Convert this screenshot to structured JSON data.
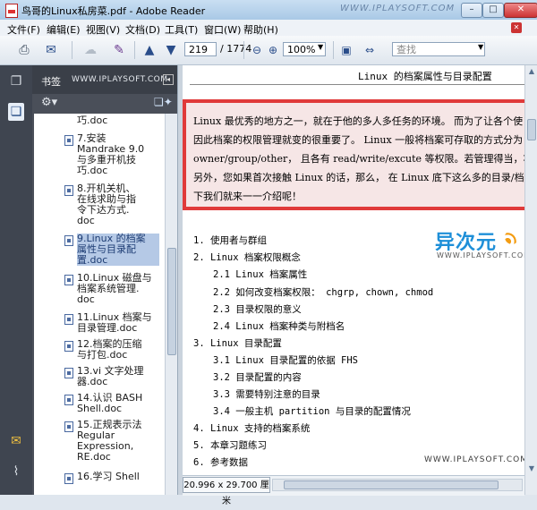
{
  "window": {
    "title": "鸟哥的Linux私房菜.pdf - Adobe Reader",
    "brand": "WWW.IPLAYSOFT.COM",
    "minimize": "–",
    "maximize": "□",
    "close": "✕"
  },
  "menu": [
    "文件(F)",
    "编辑(E)",
    "视图(V)",
    "文档(D)",
    "工具(T)",
    "窗口(W)",
    "帮助(H)"
  ],
  "toolbar": {
    "page_current": "219",
    "page_total": "/ 1774",
    "zoom": "100%",
    "search_placeholder": "查找"
  },
  "bookmarks": {
    "header": "书签",
    "brand": "WWW.IPLAYSOFT.COM",
    "items": [
      "巧.doc",
      "7.安装\nMandrake 9.0\n与多重开机技\n巧.doc",
      "8.开机关机、\n在线求助与指\n令下达方式.\ndoc",
      "9.Linux 的档案\n属性与目录配\n置.doc",
      "10.Linux 磁盘与\n档案系统管理.\ndoc",
      "11.Linux 档案与\n目录管理.doc",
      "12.档案的压缩\n与打包.doc",
      "13.vi 文字处理\n器.doc",
      "14.认识 BASH\nShell.doc",
      "15.正规表示法\nRegular\nExpression,\nRE.doc",
      "16.学习 Shell"
    ],
    "selected_index": 3
  },
  "document": {
    "running_head": "Linux 的档案属性与目录配置",
    "callout_lines": [
      "Linux 最优秀的地方之一，就在于他的多人多任务的环境。 而为了让各个使",
      "因此档案的权限管理就变的很重要了。 Linux 一般将档案可存取的方式分为",
      "owner/group/other， 且各有 read/write/excute 等权限。若管理得当，将会让您",
      "另外，您如果首次接触 Linux 的话，那么， 在 Linux 底下这么多的目录/档",
      "下我们就来一一介绍呢！"
    ],
    "logo_text": "异次元",
    "logo_sub": "WWW.IPLAYSOFT.COM",
    "toc": [
      "1. 使用者与群组",
      "2. Linux 档案权限概念",
      "2.1 Linux 档案属性",
      "2.2 如何改变档案权限： chgrp, chown, chmod",
      "2.3 目录权限的意义",
      "2.4 Linux 档案种类与附档名",
      "3. Linux 目录配置",
      "3.1 Linux 目录配置的依据 FHS",
      "3.2 目录配置的内容",
      "3.3 需要特别注意的目录",
      "3.4 一般主机 partition 与目录的配置情况",
      "4. Linux 支持的档案系统",
      "5. 本章习题练习",
      "6. 参考数据"
    ],
    "brand": "WWW.IPLAYSOFT.COM"
  },
  "status": {
    "page_size": "20.996 x 29.700 厘米"
  }
}
